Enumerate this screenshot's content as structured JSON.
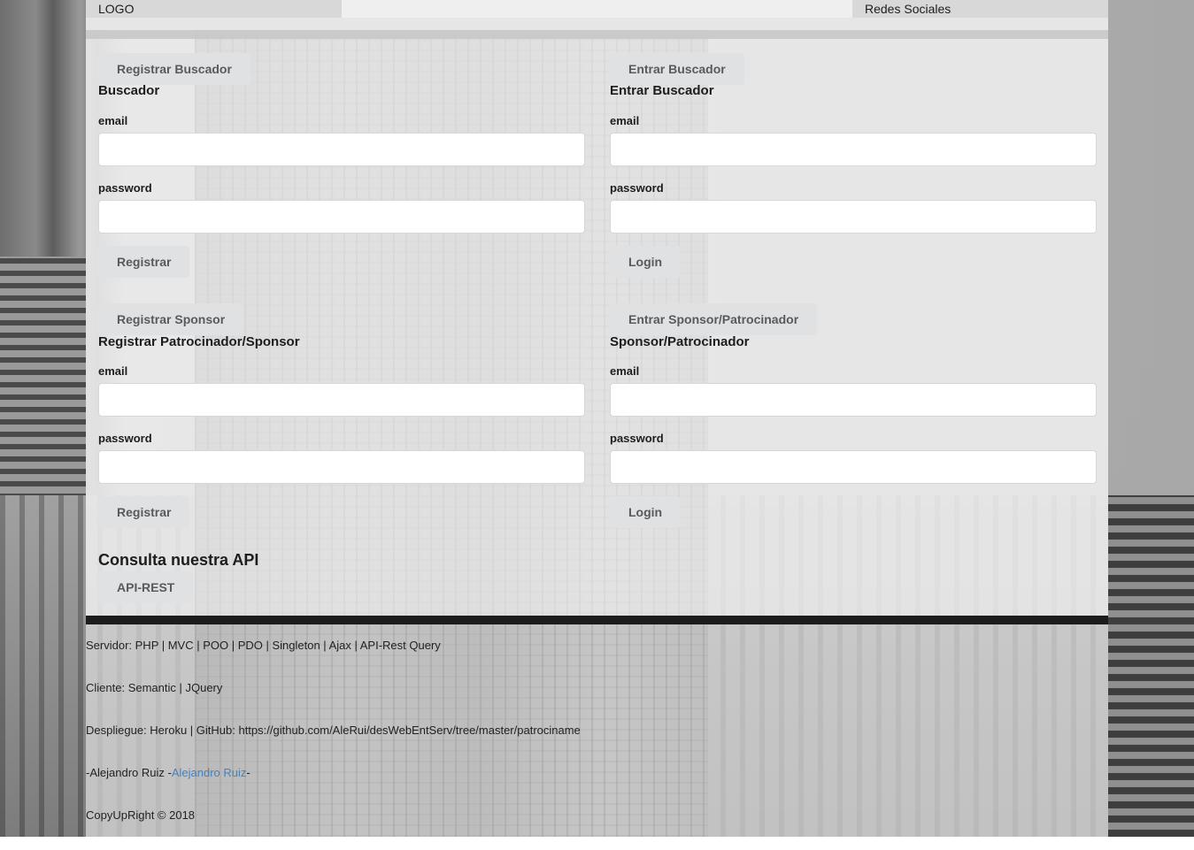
{
  "header": {
    "logo": "LOGO",
    "social": "Redes Sociales"
  },
  "forms": {
    "register_searcher": {
      "tab_button": "Registrar Buscador",
      "title": "Buscador",
      "email_label": "email",
      "password_label": "password",
      "submit": "Registrar"
    },
    "login_searcher": {
      "tab_button": "Entrar Buscador",
      "title": "Entrar Buscador",
      "email_label": "email",
      "password_label": "password",
      "submit": "Login"
    },
    "register_sponsor": {
      "tab_button": "Registrar Sponsor",
      "title": "Registrar Patrocinador/Sponsor",
      "email_label": "email",
      "password_label": "password",
      "submit": "Registrar"
    },
    "login_sponsor": {
      "tab_button": "Entrar Sponsor/Patrocinador",
      "title": "Sponsor/Patrocinador",
      "email_label": "email",
      "password_label": "password",
      "submit": "Login"
    }
  },
  "api": {
    "title": "Consulta nuestra API",
    "button": "API-REST"
  },
  "footer": {
    "server": "Servidor: PHP | MVC | POO | PDO | Singleton | Ajax | API-Rest Query",
    "client": "Cliente: Semantic | JQuery",
    "deploy": "Despliegue: Heroku | GitHub: https://github.com/AleRui/desWebEntServ/tree/master/patrociname",
    "author_prefix": "-Alejandro Ruiz -",
    "author_link": "Alejandro Ruiz",
    "author_suffix": "-",
    "copyright": "CopyUpRight © 2018"
  },
  "colors": {
    "link": "#4183c4",
    "button_bg": "#e0e1e2",
    "separator": "#1c1c1c"
  }
}
